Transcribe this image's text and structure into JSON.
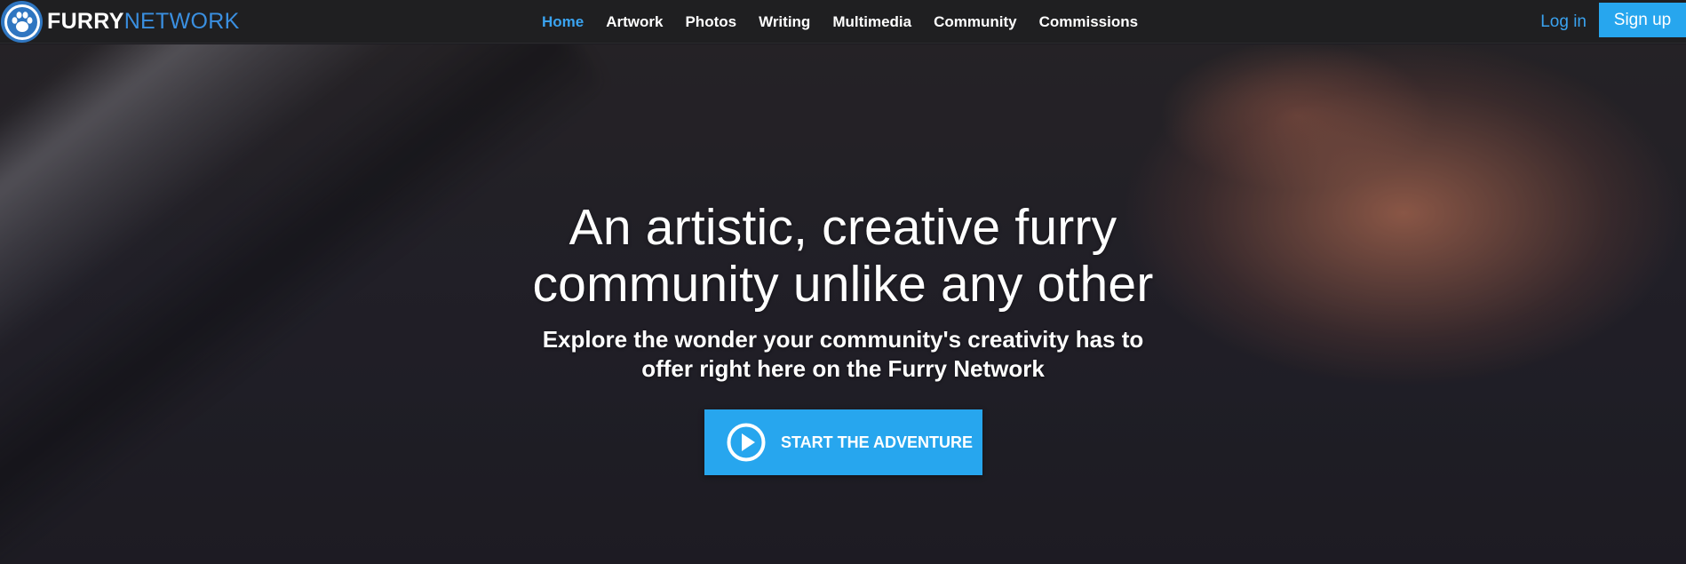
{
  "brand": {
    "name_bold": "FURRY",
    "name_light": "NETWORK",
    "logo_icon": "paw-icon"
  },
  "nav": {
    "items": [
      {
        "label": "Home",
        "active": true
      },
      {
        "label": "Artwork",
        "active": false
      },
      {
        "label": "Photos",
        "active": false
      },
      {
        "label": "Writing",
        "active": false
      },
      {
        "label": "Multimedia",
        "active": false
      },
      {
        "label": "Community",
        "active": false
      },
      {
        "label": "Commissions",
        "active": false
      }
    ]
  },
  "auth": {
    "login_label": "Log in",
    "signup_label": "Sign up"
  },
  "hero": {
    "headline_line1": "An artistic, creative furry",
    "headline_line2": "community unlike any other",
    "subline_line1": "Explore the wonder your community's creativity has to",
    "subline_line2": "offer right here on the Furry Network",
    "cta_label": "START THE ADVENTURE",
    "cta_icon": "play-circle-icon"
  },
  "colors": {
    "accent": "#27a6ee",
    "link": "#3aa3f0",
    "topbar_bg": "#1f1f21",
    "brand_light": "#3a8fe0"
  }
}
